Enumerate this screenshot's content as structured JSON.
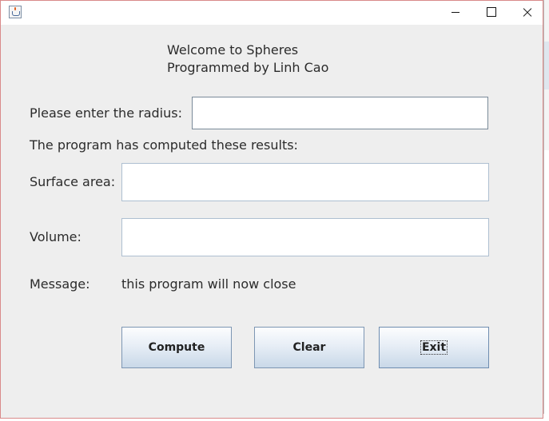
{
  "header": {
    "line1": "Welcome to Spheres",
    "line2": "Programmed by Linh Cao"
  },
  "form": {
    "radius_label": "Please enter the radius:",
    "radius_value": "",
    "results_label": "The program has computed these results:",
    "surface_label": "Surface area:",
    "surface_value": "",
    "volume_label": "Volume:",
    "volume_value": "",
    "message_label": "Message:",
    "message_text": "this program will now close"
  },
  "buttons": {
    "compute": "Compute",
    "clear": "Clear",
    "exit": "Exit"
  },
  "colors": {
    "window_bg": "#eeeeee",
    "button_border": "#7d96b3"
  }
}
